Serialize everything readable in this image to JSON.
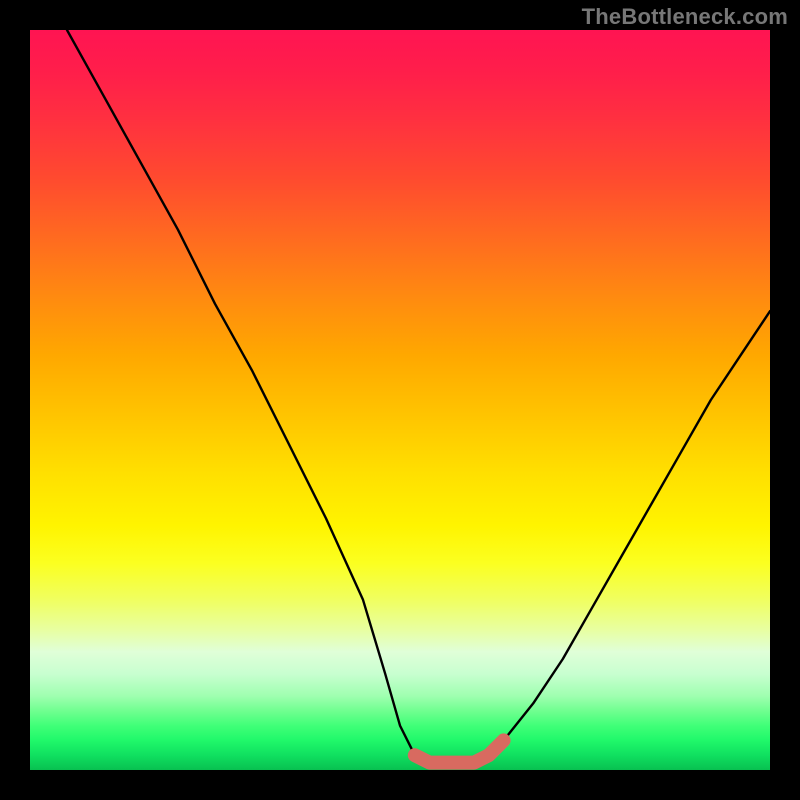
{
  "watermark": "TheBottleneck.com",
  "chart_data": {
    "type": "line",
    "title": "",
    "xlabel": "",
    "ylabel": "",
    "xlim": [
      0,
      100
    ],
    "ylim": [
      0,
      100
    ],
    "series": [
      {
        "name": "bottleneck-curve",
        "x": [
          5,
          10,
          15,
          20,
          25,
          30,
          35,
          40,
          45,
          48,
          50,
          52,
          54,
          56,
          58,
          60,
          62,
          64,
          68,
          72,
          76,
          80,
          84,
          88,
          92,
          96,
          100
        ],
        "values": [
          100,
          91,
          82,
          73,
          63,
          54,
          44,
          34,
          23,
          13,
          6,
          2,
          1,
          1,
          1,
          1,
          2,
          4,
          9,
          15,
          22,
          29,
          36,
          43,
          50,
          56,
          62
        ]
      }
    ],
    "annotations": [
      {
        "name": "optimal-zone",
        "x_range": [
          52,
          64
        ],
        "color": "#d86a60"
      }
    ],
    "background_gradient": {
      "top": "#ff1452",
      "mid": "#ffe000",
      "bottom": "#08c050"
    }
  }
}
